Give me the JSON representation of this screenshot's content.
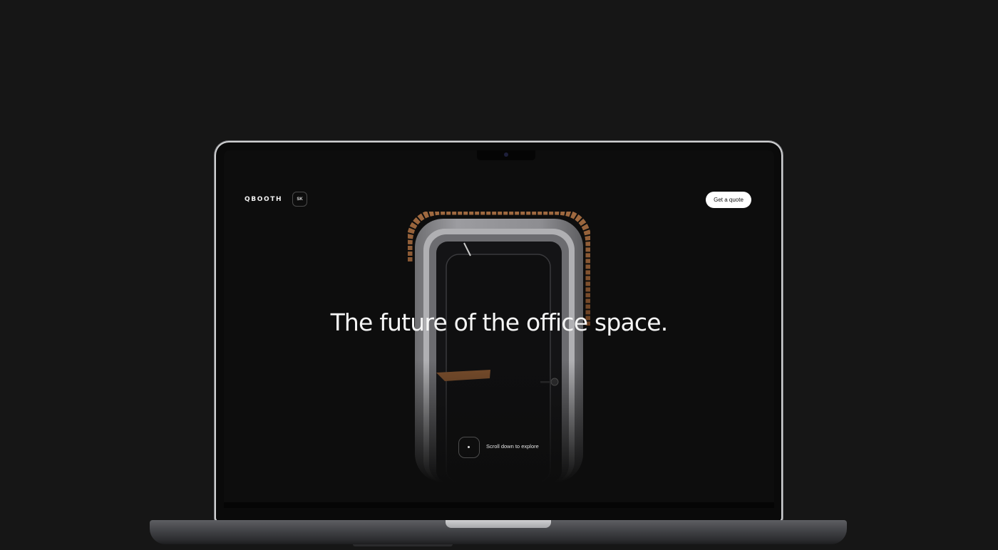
{
  "nav": {
    "logo": "QBOOTH",
    "language": "SK",
    "cta_label": "Get a quote"
  },
  "hero": {
    "headline": "The future of the office space.",
    "scroll_label": "Scroll down to explore"
  },
  "colors": {
    "background": "#161616",
    "screen_background": "#0d0d0d",
    "accent_wood": "#8a5a35",
    "cta_background": "#ffffff"
  },
  "icons": {
    "scroll": "scroll-indicator-icon",
    "camera": "camera-icon"
  }
}
